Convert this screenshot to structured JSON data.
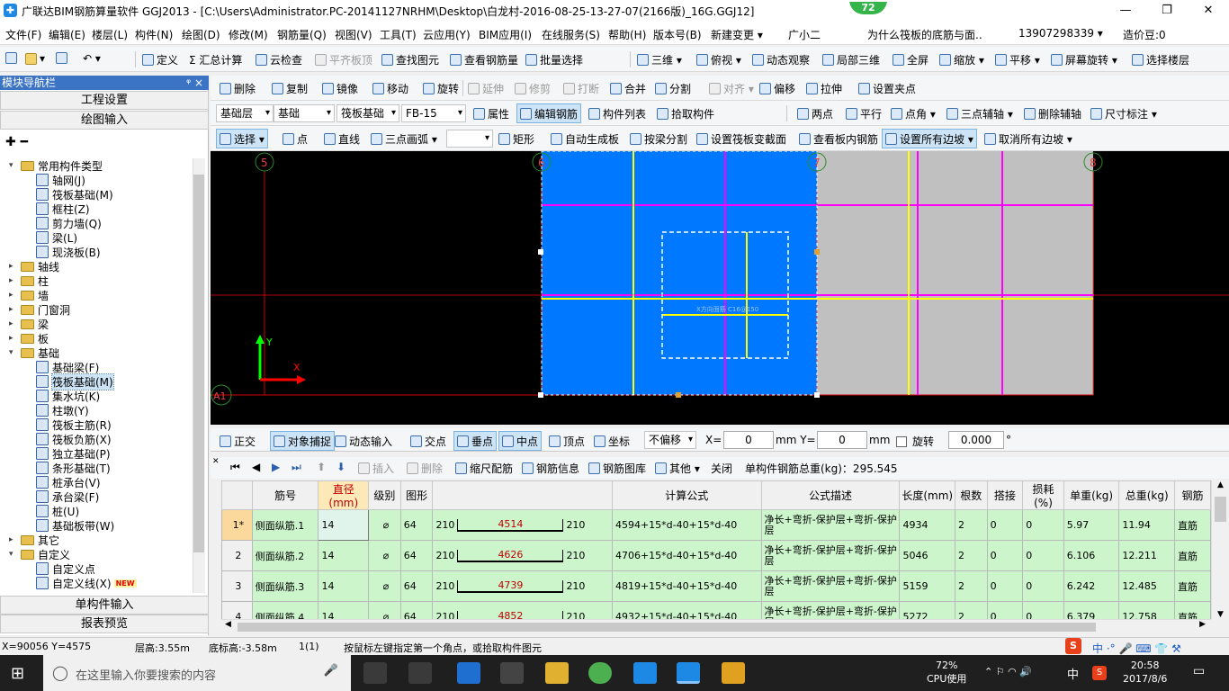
{
  "titlebar": {
    "title": "广联达BIM钢筋算量软件 GGJ2013 - [C:\\Users\\Administrator.PC-20141127NRHM\\Desktop\\白龙村-2016-08-25-13-27-07(2166版)_16G.GGJ12]",
    "badge": "72",
    "minimize": "—",
    "restore": "❐",
    "close": "✕"
  },
  "menu": [
    "文件(F)",
    "编辑(E)",
    "楼层(L)",
    "构件(N)",
    "绘图(D)",
    "修改(M)",
    "钢筋量(Q)",
    "视图(V)",
    "工具(T)",
    "云应用(Y)",
    "BIM应用(I)",
    "在线服务(S)",
    "帮助(H)",
    "版本号(B)",
    "新建变更 ▾",
    "广小二",
    "为什么筏板的底筋与面..",
    "13907298339 ▾",
    "造价豆:0"
  ],
  "toolbar1": [
    "定义",
    "Σ 汇总计算",
    "云检查",
    "平齐板顶",
    "查找图元",
    "查看钢筋量",
    "批量选择",
    "三维 ▾",
    "俯视 ▾",
    "动态观察",
    "局部三维",
    "全屏",
    "缩放 ▾",
    "平移 ▾",
    "屏幕旋转 ▾",
    "选择楼层"
  ],
  "toolbar2": [
    "删除",
    "复制",
    "镜像",
    "移动",
    "旋转",
    "延伸",
    "修剪",
    "打断",
    "合并",
    "分割",
    "对齐 ▾",
    "偏移",
    "拉伸",
    "设置夹点"
  ],
  "toolbar3": {
    "floor": "基础层",
    "type": "基础",
    "sub": "筏板基础",
    "item": "FB-15",
    "attr": "属性",
    "edit_rebar": "编辑钢筋",
    "list": "构件列表",
    "pick": "拾取构件",
    "two_point": "两点",
    "parallel": "平行",
    "point_angle": "点角 ▾",
    "three_axis": "三点辅轴 ▾",
    "del_axis": "删除辅轴",
    "dim": "尺寸标注 ▾"
  },
  "toolbar4": [
    "选择 ▾",
    "点",
    "直线",
    "三点画弧 ▾",
    "矩形",
    "自动生成板",
    "按梁分割",
    "设置筏板变截面",
    "查看板内钢筋",
    "设置所有边坡 ▾",
    "取消所有边坡 ▾"
  ],
  "leftpanel": {
    "header": "模块导航栏",
    "pin": "ᵠ ×",
    "tab1": "工程设置",
    "tab2": "绘图输入",
    "tab3": "单构件输入",
    "tab4": "报表预览"
  },
  "tree": [
    {
      "label": "常用构件类型",
      "level": 0,
      "exp": "▾",
      "kind": "folder"
    },
    {
      "label": "轴网(J)",
      "level": 1,
      "kind": "comp"
    },
    {
      "label": "筏板基础(M)",
      "level": 1,
      "kind": "comp"
    },
    {
      "label": "框柱(Z)",
      "level": 1,
      "kind": "comp"
    },
    {
      "label": "剪力墙(Q)",
      "level": 1,
      "kind": "comp"
    },
    {
      "label": "梁(L)",
      "level": 1,
      "kind": "comp"
    },
    {
      "label": "现浇板(B)",
      "level": 1,
      "kind": "comp"
    },
    {
      "label": "轴线",
      "level": 0,
      "exp": "▸",
      "kind": "folder"
    },
    {
      "label": "柱",
      "level": 0,
      "exp": "▸",
      "kind": "folder"
    },
    {
      "label": "墙",
      "level": 0,
      "exp": "▸",
      "kind": "folder"
    },
    {
      "label": "门窗洞",
      "level": 0,
      "exp": "▸",
      "kind": "folder"
    },
    {
      "label": "梁",
      "level": 0,
      "exp": "▸",
      "kind": "folder"
    },
    {
      "label": "板",
      "level": 0,
      "exp": "▸",
      "kind": "folder"
    },
    {
      "label": "基础",
      "level": 0,
      "exp": "▾",
      "kind": "folder"
    },
    {
      "label": "基础梁(F)",
      "level": 1,
      "kind": "comp"
    },
    {
      "label": "筏板基础(M)",
      "level": 1,
      "kind": "comp",
      "sel": true
    },
    {
      "label": "集水坑(K)",
      "level": 1,
      "kind": "comp"
    },
    {
      "label": "柱墩(Y)",
      "level": 1,
      "kind": "comp"
    },
    {
      "label": "筏板主筋(R)",
      "level": 1,
      "kind": "comp"
    },
    {
      "label": "筏板负筋(X)",
      "level": 1,
      "kind": "comp"
    },
    {
      "label": "独立基础(P)",
      "level": 1,
      "kind": "comp"
    },
    {
      "label": "条形基础(T)",
      "level": 1,
      "kind": "comp"
    },
    {
      "label": "桩承台(V)",
      "level": 1,
      "kind": "comp"
    },
    {
      "label": "承台梁(F)",
      "level": 1,
      "kind": "comp"
    },
    {
      "label": "桩(U)",
      "level": 1,
      "kind": "comp"
    },
    {
      "label": "基础板带(W)",
      "level": 1,
      "kind": "comp"
    },
    {
      "label": "其它",
      "level": 0,
      "exp": "▸",
      "kind": "folder"
    },
    {
      "label": "自定义",
      "level": 0,
      "exp": "▾",
      "kind": "folder"
    },
    {
      "label": "自定义点",
      "level": 1,
      "kind": "comp"
    },
    {
      "label": "自定义线(X)",
      "level": 1,
      "kind": "comp",
      "badge": "NEW"
    }
  ],
  "canvas": {
    "axis_labels": [
      "5",
      "6",
      "7",
      "8",
      "A1"
    ],
    "axis_y": "Y",
    "axis_x": "X",
    "rebar_text": "X方向面筋 C16@150"
  },
  "snapbar": {
    "ortho": "正交",
    "snap": "对象捕捉",
    "dyn": "动态输入",
    "cross": "交点",
    "perp": "垂点",
    "mid": "中点",
    "vertex": "顶点",
    "coord": "坐标",
    "offset": "不偏移",
    "x_label": "X=",
    "x_val": "0",
    "y_label": "mm Y=",
    "y_val": "0",
    "mm": "mm",
    "rotate": "旋转",
    "rot_val": "0.000",
    "deg": "°"
  },
  "gridtb": {
    "insert": "插入",
    "delete": "删除",
    "scale": "缩尺配筋",
    "info": "钢筋信息",
    "lib": "钢筋图库",
    "other": "其他 ▾",
    "close": "关闭",
    "total_label": "单构件钢筋总重(kg)：295.545"
  },
  "table": {
    "headers": [
      "",
      "筋号",
      "直径(mm)",
      "级别",
      "图形",
      "",
      "计算公式",
      "公式描述",
      "长度(mm)",
      "根数",
      "搭接",
      "损耗(%)",
      "单重(kg)",
      "总重(kg)",
      "钢筋"
    ],
    "rows": [
      {
        "rn": "1*",
        "name": "侧面纵筋.1",
        "dia": "14",
        "grade": "⌀",
        "fig": "64",
        "l": "210",
        "mid": "4514",
        "r": "210",
        "formula": "4594+15*d-40+15*d-40",
        "desc": "净长+弯折-保护层+弯折-保护层",
        "len": "4934",
        "num": "2",
        "lap": "0",
        "loss": "0",
        "unit": "5.97",
        "total": "11.94",
        "type": "直筋"
      },
      {
        "rn": "2",
        "name": "侧面纵筋.2",
        "dia": "14",
        "grade": "⌀",
        "fig": "64",
        "l": "210",
        "mid": "4626",
        "r": "210",
        "formula": "4706+15*d-40+15*d-40",
        "desc": "净长+弯折-保护层+弯折-保护层",
        "len": "5046",
        "num": "2",
        "lap": "0",
        "loss": "0",
        "unit": "6.106",
        "total": "12.211",
        "type": "直筋"
      },
      {
        "rn": "3",
        "name": "侧面纵筋.3",
        "dia": "14",
        "grade": "⌀",
        "fig": "64",
        "l": "210",
        "mid": "4739",
        "r": "210",
        "formula": "4819+15*d-40+15*d-40",
        "desc": "净长+弯折-保护层+弯折-保护层",
        "len": "5159",
        "num": "2",
        "lap": "0",
        "loss": "0",
        "unit": "6.242",
        "total": "12.485",
        "type": "直筋"
      },
      {
        "rn": "4",
        "name": "侧面纵筋.4",
        "dia": "14",
        "grade": "⌀",
        "fig": "64",
        "l": "210",
        "mid": "4852",
        "r": "210",
        "formula": "4932+15*d-40+15*d-40",
        "desc": "净长+弯折-保护层+弯折-保护层",
        "len": "5272",
        "num": "2",
        "lap": "0",
        "loss": "0",
        "unit": "6.379",
        "total": "12.758",
        "type": "直筋"
      }
    ]
  },
  "statusbar": {
    "coords": "X=90056 Y=4575",
    "floor_h": "层高:3.55m",
    "base_h": "底标高:-3.58m",
    "count": "1(1)",
    "hint": "按鼠标左键指定第一个角点，或拾取构件图元"
  },
  "taskbar": {
    "search": "在这里输入你要搜索的内容",
    "cpu_pct": "72%",
    "cpu_label": "CPU使用",
    "ime": "中",
    "time": "20:58",
    "date": "2017/8/6"
  },
  "colors": {
    "canvas_bg": "#000000",
    "slab_blue": "#0078ff",
    "slab_gray": "#c0c0c0",
    "rebar_yellow": "#ffff00",
    "rebar_magenta": "#ff00ff",
    "axis_red": "#d00000",
    "row_green": "#ccf5cc"
  }
}
